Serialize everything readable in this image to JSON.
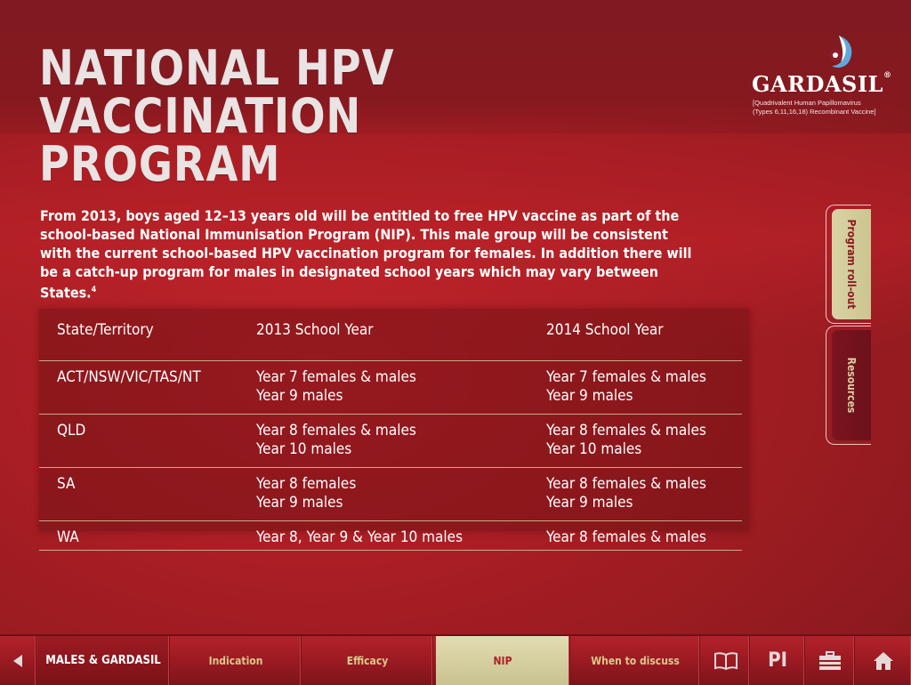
{
  "title_lines": [
    "NATIONAL HPV",
    "VACCINATION",
    "PROGRAM"
  ],
  "logo": {
    "word": "GARDASIL",
    "reg": "®",
    "sub_line1": "[Quadrivalent Human Papillomavirus",
    "sub_line2": "(Types 6,11,16,18) Recombinant Vaccine]"
  },
  "intro": {
    "text": "From 2013, boys aged 12–13 years old will be entitled to free HPV vaccine as part of the school-based National Immunisation Program (NIP). This male group will be consistent with the current school-based HPV vaccination program for females. In addition there will be a catch-up program for males in designated school years which may vary between States.",
    "footnote": "4"
  },
  "table": {
    "headers": [
      "State/Territory",
      "2013 School Year",
      "2014 School Year"
    ],
    "rows": [
      {
        "state": "ACT/NSW/VIC/TAS/NT",
        "y2013": [
          "Year 7 females & males",
          "Year 9 males"
        ],
        "y2014": [
          "Year 7 females & males",
          "Year 9 males"
        ]
      },
      {
        "state": "QLD",
        "y2013": [
          "Year 8 females & males",
          "Year 10 males"
        ],
        "y2014": [
          "Year 8 females & males",
          "Year 10 males"
        ]
      },
      {
        "state": "SA",
        "y2013": [
          "Year 8 females",
          "Year 9 males"
        ],
        "y2014": [
          "Year 8 females & males",
          "Year 9 males"
        ]
      },
      {
        "state": "WA",
        "y2013": [
          "Year 8, Year 9 & Year 10 males"
        ],
        "y2014": [
          "Year 8 females & males"
        ]
      }
    ]
  },
  "side_tabs": {
    "rollout": "Program roll-out",
    "resources": "Resources"
  },
  "nav": {
    "back_icon": "back-arrow-icon",
    "males": "MALES & GARDASIL",
    "indication": "Indication",
    "efficacy": "Efficacy",
    "nip": "NIP",
    "when": "When to discuss",
    "pi": "PI",
    "book_icon": "book-icon",
    "briefcase_icon": "briefcase-icon",
    "home_icon": "home-icon"
  },
  "colors": {
    "background": "#a41d23",
    "title": "#e9e3e3",
    "active_tab": "#d9d3a6",
    "nav_text": "#d9c98a"
  }
}
